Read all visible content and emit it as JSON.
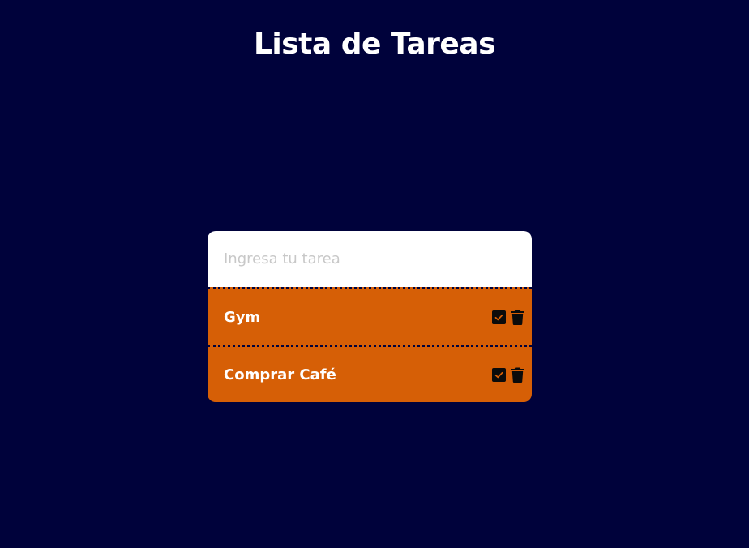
{
  "title": "Lista de Tareas",
  "input": {
    "placeholder": "Ingresa tu tarea",
    "value": ""
  },
  "tasks": [
    {
      "text": "Gym",
      "check_icon": "check-square-icon",
      "delete_icon": "trash-icon"
    },
    {
      "text": "Comprar Café",
      "check_icon": "check-square-icon",
      "delete_icon": "trash-icon"
    }
  ],
  "colors": {
    "background": "#00023b",
    "card_input": "#ffffff",
    "task_background": "#d65f06",
    "task_text": "#ffffff",
    "icon": "#0b0b0b"
  }
}
